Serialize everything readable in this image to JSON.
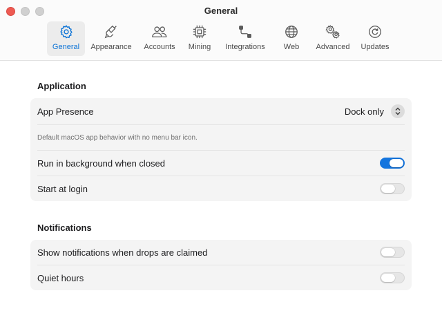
{
  "window": {
    "title": "General"
  },
  "toolbar": {
    "tabs": [
      {
        "label": "General",
        "icon": "gear-icon",
        "active": true
      },
      {
        "label": "Appearance",
        "icon": "paintbrush-icon",
        "active": false
      },
      {
        "label": "Accounts",
        "icon": "people-icon",
        "active": false
      },
      {
        "label": "Mining",
        "icon": "chip-icon",
        "active": false
      },
      {
        "label": "Integrations",
        "icon": "connection-icon",
        "active": false
      },
      {
        "label": "Web",
        "icon": "globe-icon",
        "active": false
      },
      {
        "label": "Advanced",
        "icon": "gears-icon",
        "active": false
      },
      {
        "label": "Updates",
        "icon": "refresh-icon",
        "active": false
      }
    ]
  },
  "application": {
    "title": "Application",
    "app_presence": {
      "label": "App Presence",
      "value": "Dock only"
    },
    "description": "Default macOS app behavior with no menu bar icon.",
    "run_in_background": {
      "label": "Run in background when closed",
      "enabled": true
    },
    "start_at_login": {
      "label": "Start at login",
      "enabled": false
    }
  },
  "notifications": {
    "title": "Notifications",
    "drops_claimed": {
      "label": "Show notifications when drops are claimed",
      "enabled": false
    },
    "quiet_hours": {
      "label": "Quiet hours",
      "enabled": false
    }
  },
  "colors": {
    "accent": "#1475de",
    "active_tab_text": "#0a72d6",
    "close_button": "#ee5a52"
  }
}
